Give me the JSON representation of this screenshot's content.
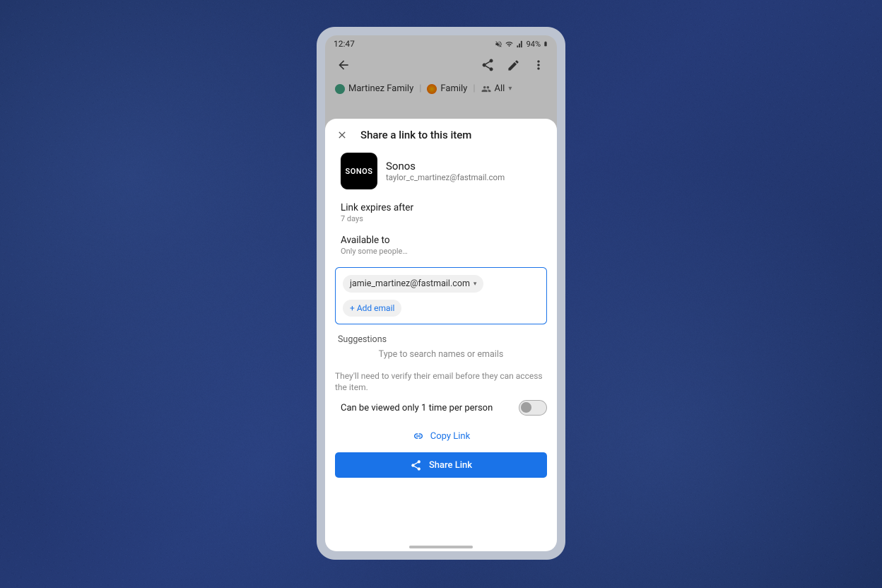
{
  "status": {
    "time": "12:47",
    "battery": "94%"
  },
  "breadcrumb": {
    "item1": "Martinez Family",
    "item2": "Family",
    "item3": "All"
  },
  "sheet": {
    "title": "Share a link to this item",
    "item": {
      "logo_text": "SONOS",
      "name": "Sonos",
      "email": "taylor_c_martinez@fastmail.com"
    },
    "expires": {
      "label": "Link expires after",
      "value": "7 days"
    },
    "available": {
      "label": "Available to",
      "value": "Only some people…"
    },
    "recipient_chip": "jamie_martinez@fastmail.com",
    "add_email": "Add email",
    "suggestions_label": "Suggestions",
    "suggestions_hint": "Type to search names or emails",
    "verify_note": "They'll need to verify their email before they can access the item.",
    "toggle_label": "Can be viewed only 1 time per person",
    "copy_link": "Copy Link",
    "share_button": "Share Link"
  }
}
